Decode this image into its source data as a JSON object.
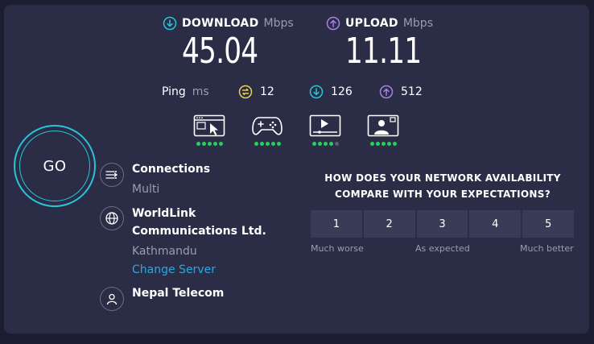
{
  "download": {
    "label": "DOWNLOAD",
    "unit": "Mbps",
    "value": "45.04"
  },
  "upload": {
    "label": "UPLOAD",
    "unit": "Mbps",
    "value": "11.11"
  },
  "ping": {
    "label": "Ping",
    "unit": "ms",
    "idle": "12",
    "download": "126",
    "upload": "512"
  },
  "experience": [
    {
      "name": "web-browsing",
      "score": 5,
      "max": 5
    },
    {
      "name": "gaming",
      "score": 5,
      "max": 5
    },
    {
      "name": "video-streaming",
      "score": 4,
      "max": 5
    },
    {
      "name": "video-chat",
      "score": 5,
      "max": 5
    }
  ],
  "go": {
    "label": "GO"
  },
  "connections": {
    "title": "Connections",
    "value": "Multi"
  },
  "server": {
    "name_line1": "WorldLink",
    "name_line2": "Communications Ltd.",
    "location": "Kathmandu",
    "change_label": "Change Server"
  },
  "isp": {
    "name": "Nepal Telecom"
  },
  "survey": {
    "question_line1": "HOW DOES YOUR NETWORK AVAILABILITY",
    "question_line2": "COMPARE WITH YOUR EXPECTATIONS?",
    "options": [
      "1",
      "2",
      "3",
      "4",
      "5"
    ],
    "low": "Much worse",
    "mid": "As expected",
    "high": "Much better"
  },
  "colors": {
    "download": "#27c5d6",
    "upload": "#a780e8",
    "idle": "#e8d24a",
    "good": "#26d05c",
    "accent": "#2ca7e0",
    "panel": "#2b2d46"
  }
}
